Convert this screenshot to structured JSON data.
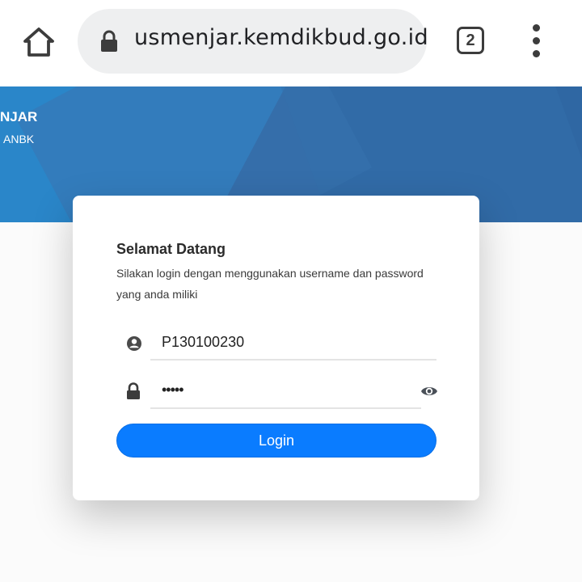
{
  "browser": {
    "url": "usmenjar.kemdikbud.go.id",
    "tab_count": "2",
    "home_icon": "home-icon",
    "lock_icon": "lock-icon",
    "menu_icon": "more-vert-icon"
  },
  "banner": {
    "title": "NJAR",
    "subtitle": "ANBK",
    "color": "#2f67a3"
  },
  "login": {
    "heading": "Selamat Datang",
    "description": "Silakan login dengan menggunakan username dan password yang anda miliki",
    "username_value": "P130100230",
    "password_value": "•••••",
    "button_label": "Login",
    "button_color": "#0a7cff",
    "user_icon": "account-circle-icon",
    "password_icon": "lock-icon",
    "show_password_icon": "eye-icon"
  }
}
